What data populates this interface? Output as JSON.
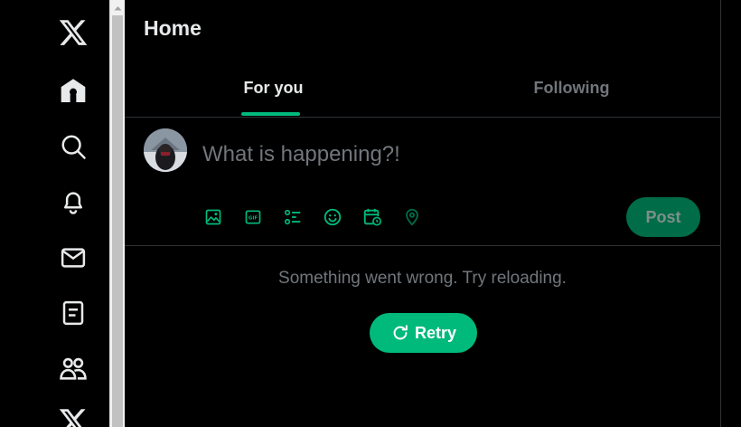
{
  "colors": {
    "accent": "#00ba7c",
    "background": "#000000",
    "text_primary": "#e7e9ea",
    "text_secondary": "#71767b",
    "divider": "#2f3336",
    "post_disabled_bg": "#006c48"
  },
  "nav": {
    "items": [
      {
        "icon": "x-logo-icon"
      },
      {
        "icon": "home-icon"
      },
      {
        "icon": "search-icon"
      },
      {
        "icon": "bell-icon"
      },
      {
        "icon": "mail-icon"
      },
      {
        "icon": "lists-icon"
      },
      {
        "icon": "communities-icon"
      },
      {
        "icon": "premium-x-icon"
      }
    ]
  },
  "header": {
    "title": "Home"
  },
  "tabs": [
    {
      "label": "For you",
      "active": true
    },
    {
      "label": "Following",
      "active": false
    }
  ],
  "composer": {
    "placeholder": "What is happening?!",
    "value": "",
    "tools": [
      "media-icon",
      "gif-icon",
      "poll-icon",
      "emoji-icon",
      "schedule-icon",
      "location-icon"
    ],
    "post_label": "Post"
  },
  "feed": {
    "error_message": "Something went wrong. Try reloading.",
    "retry_label": "Retry"
  }
}
